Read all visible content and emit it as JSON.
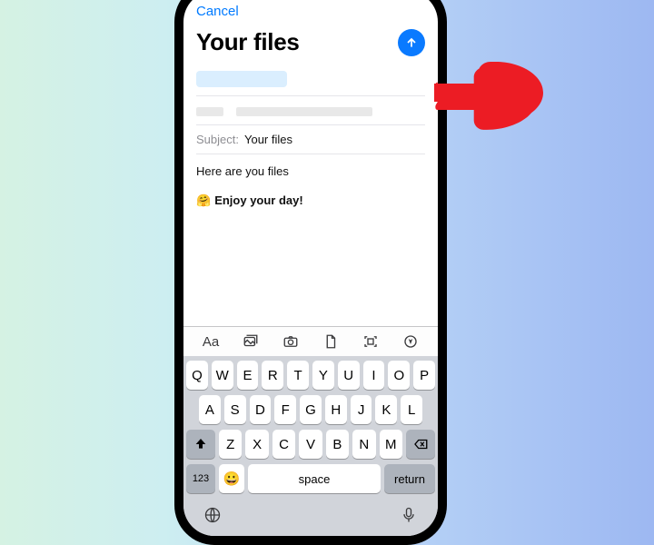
{
  "nav": {
    "cancel": "Cancel",
    "title": "Your files"
  },
  "compose": {
    "subject_label": "Subject:",
    "subject_value": "Your files",
    "body_line": "Here are you files",
    "enjoy_emoji": "🤗",
    "enjoy_text": "Enjoy your day!"
  },
  "toolbar": {
    "text_format": "Aa"
  },
  "keyboard": {
    "row1": [
      "Q",
      "W",
      "E",
      "R",
      "T",
      "Y",
      "U",
      "I",
      "O",
      "P"
    ],
    "row2": [
      "A",
      "S",
      "D",
      "F",
      "G",
      "H",
      "J",
      "K",
      "L"
    ],
    "row3": [
      "Z",
      "X",
      "C",
      "V",
      "B",
      "N",
      "M"
    ],
    "numKey": "123",
    "space": "space",
    "return": "return"
  }
}
